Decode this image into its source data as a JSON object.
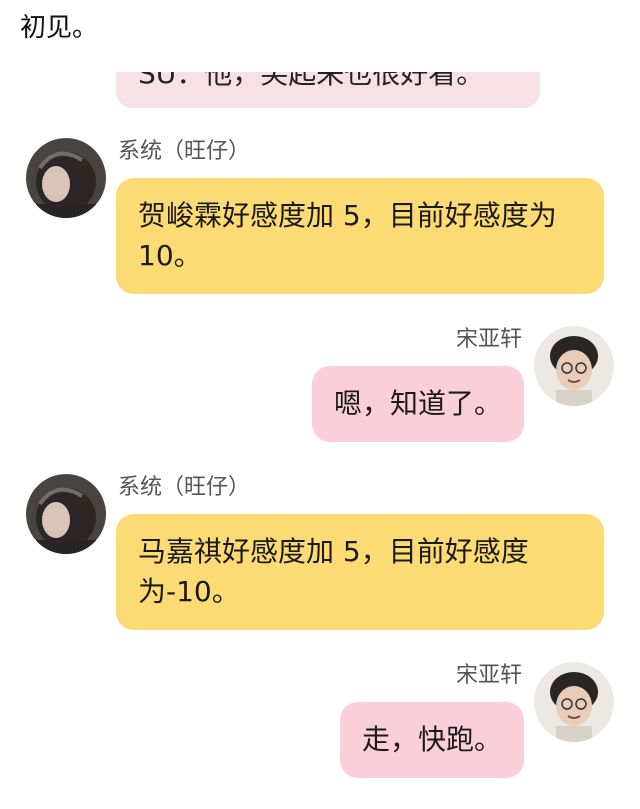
{
  "top_text": "初见。",
  "partial_bubble_text": "SU：他，笑起来也很好看。",
  "messages": [
    {
      "sender": "系统（旺仔）",
      "text": "贺峻霖好感度加 5，目前好感度为 10。",
      "side": "left",
      "avatar_icon": "girl-avatar-icon"
    },
    {
      "sender": "宋亚轩",
      "text": "嗯，知道了。",
      "side": "right",
      "avatar_icon": "boy-avatar-icon"
    },
    {
      "sender": "系统（旺仔）",
      "text": "马嘉祺好感度加 5，目前好感度为-10。",
      "side": "left",
      "avatar_icon": "girl-avatar-icon"
    },
    {
      "sender": "宋亚轩",
      "text": "走，快跑。",
      "side": "right",
      "avatar_icon": "boy-avatar-icon"
    }
  ],
  "colors": {
    "system_bubble": "#fcdb74",
    "user_bubble": "#fbcfda",
    "partial_bubble": "#f7e1e4",
    "sender_text": "#555555"
  }
}
